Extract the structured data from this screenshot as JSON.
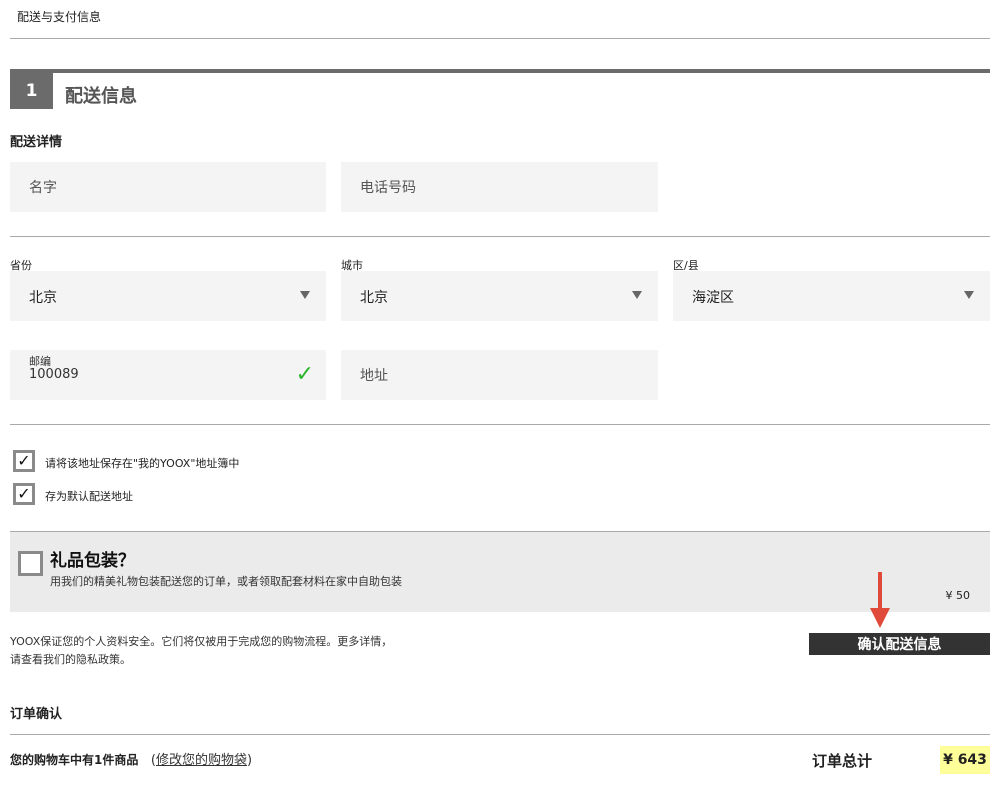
{
  "breadcrumb": "配送与支付信息",
  "step": {
    "number": "1",
    "title": "配送信息"
  },
  "details_heading": "配送详情",
  "name_field": {
    "placeholder": "名字"
  },
  "phone_field": {
    "placeholder": "电话号码"
  },
  "province": {
    "label": "省份",
    "value": "北京"
  },
  "city": {
    "label": "城市",
    "value": "北京"
  },
  "district": {
    "label": "区/县",
    "value": "海淀区"
  },
  "zip": {
    "label": "邮编",
    "value": "100089",
    "valid_icon": "✓"
  },
  "address_field": {
    "placeholder": "地址"
  },
  "save_address": {
    "label": "请将该地址保存在\"我的YOOX\"地址簿中",
    "checked": true,
    "mark": "✓"
  },
  "default_address": {
    "label": "存为默认配送地址",
    "checked": true,
    "mark": "✓"
  },
  "gift": {
    "title": "礼品包装？",
    "description": "用我们的精美礼物包装配送您的订单，或者领取配套材料在家中自助包装",
    "price": "¥ 50"
  },
  "privacy": {
    "line1": "YOOX保证您的个人资料安全。它们将仅被用于完成您的购物流程。更多详情，",
    "line2": "请查看我们的隐私政策。"
  },
  "confirm_button": "确认配送信息",
  "order_confirm_heading": "订单确认",
  "cart": {
    "summary": "您的购物车中有1件商品",
    "paren_open": "(",
    "edit_link": "修改您的购物袋",
    "paren_close": ")"
  },
  "order_total": {
    "label": "订单总计",
    "value": "¥ 643"
  },
  "colors": {
    "accent_dark": "#6b6b6b",
    "button": "#333333",
    "valid": "#2ab52a",
    "total_highlight": "#ffff99",
    "arrow": "#e04a3a"
  }
}
